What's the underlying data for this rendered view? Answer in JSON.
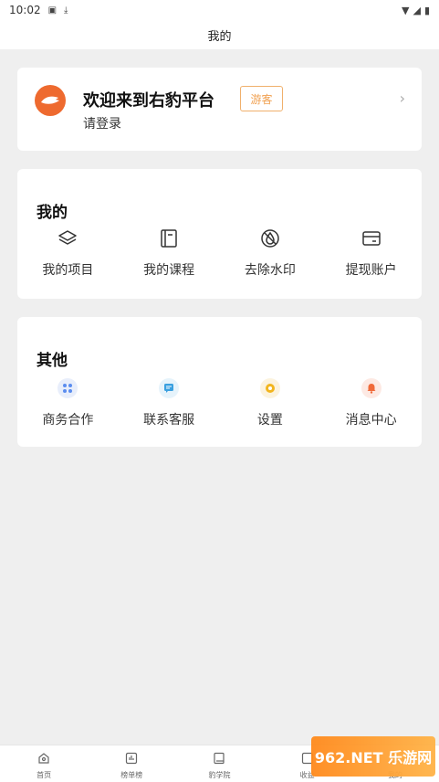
{
  "status_bar": {
    "time": "10:02",
    "icons": [
      "a-icon",
      "download-icon",
      "wifi-icon",
      "signal-icon",
      "battery-icon"
    ]
  },
  "header": {
    "title": "我的"
  },
  "profile": {
    "welcome": "欢迎来到右豹平台",
    "login": "请登录",
    "guest_label": "游客"
  },
  "mine": {
    "title": "我的",
    "items": [
      {
        "label": "我的项目",
        "icon": "layers-icon"
      },
      {
        "label": "我的课程",
        "icon": "book-icon"
      },
      {
        "label": "去除水印",
        "icon": "no-watermark-icon"
      },
      {
        "label": "提现账户",
        "icon": "card-icon"
      }
    ]
  },
  "other": {
    "title": "其他",
    "items": [
      {
        "label": "商务合作",
        "icon": "apps-icon"
      },
      {
        "label": "联系客服",
        "icon": "chat-icon"
      },
      {
        "label": "设置",
        "icon": "gear-icon"
      },
      {
        "label": "消息中心",
        "icon": "bell-icon"
      }
    ]
  },
  "tabs": [
    {
      "label": "首页",
      "icon": "home-icon"
    },
    {
      "label": "榜单榜",
      "icon": "chart-icon"
    },
    {
      "label": "豹学院",
      "icon": "book-icon"
    },
    {
      "label": "收益",
      "icon": "wallet-icon"
    },
    {
      "label": "我的",
      "icon": "user-icon"
    }
  ],
  "watermark": {
    "text": "962.NET 乐游网"
  },
  "colors": {
    "accent": "#ee6a2f",
    "guest_border": "#f0b06c",
    "background": "#efefef"
  }
}
